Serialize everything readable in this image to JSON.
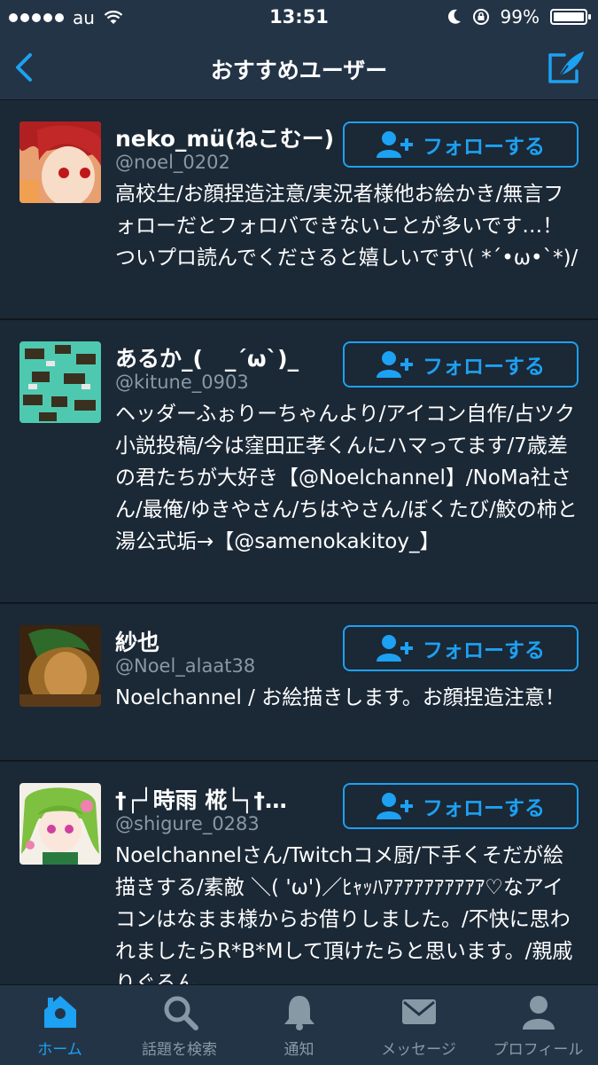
{
  "status_bar": {
    "carrier": "au",
    "time": "13:51",
    "battery": "99%"
  },
  "nav": {
    "title": "おすすめユーザー"
  },
  "follow_label": "フォローする",
  "users": [
    {
      "name": "neko_mü(ねこむー)",
      "handle": "@noel_0202",
      "bio": "高校生/お顔捏造注意/実況者様他お絵かき/無言フォローだとフォロバできないことが多いです…！ついプロ読んでくださると嬉しいです\\( *´•ω•`*)/"
    },
    {
      "name": "あるか_(　_´ω`)_",
      "handle": "@kitune_0903",
      "bio": "ヘッダーふぉりーちゃんより/アイコン自作/占ツク小説投稿/今は窪田正孝くんにハマってます/7歳差の君たちが大好き【@Noelchannel】/NoMa社さん/最俺/ゆきやさん/ちはやさん/ぼくたび/鮫の柿と湯公式垢→【@samenokakitoy_】"
    },
    {
      "name": "紗也",
      "handle": "@Noel_alaat38",
      "bio": "Noelchannel / お絵描きします。お顔捏造注意！"
    },
    {
      "name": "†┌┘時雨 椛└┐†…",
      "handle": "@shigure_0283",
      "bio": "Noelchannelさん/Twitchコメ厨/下手くそだが絵描きする/素敵 ＼( 'ω')／ﾋｬｯﾊｱｱｱｱｱｱｱｱｱｱ♡なアイコンはなまま様からお借りしました。/不快に思われましたらR*B*Mして頂けたらと思います。/親戚りぐるん"
    }
  ],
  "tabs": [
    {
      "label": "ホーム",
      "icon": "home-icon"
    },
    {
      "label": "話題を検索",
      "icon": "search-icon"
    },
    {
      "label": "通知",
      "icon": "bell-icon"
    },
    {
      "label": "メッセージ",
      "icon": "envelope-icon"
    },
    {
      "label": "プロフィール",
      "icon": "person-icon"
    }
  ],
  "colors": {
    "background": "#1b2836",
    "bar": "#243447",
    "accent": "#1da1f2",
    "secondary_text": "#8899a6"
  }
}
